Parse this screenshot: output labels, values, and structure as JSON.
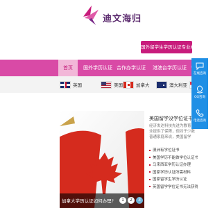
{
  "header": {
    "logo_text": "迪文海归",
    "slogan": "国外留学生学历认证专业机构"
  },
  "nav": {
    "items": [
      {
        "label": "首页",
        "active": true
      },
      {
        "label": "国外学历认证",
        "active": false
      },
      {
        "label": "合作办学认证",
        "active": false
      },
      {
        "label": "港澳台学历认证",
        "active": false
      },
      {
        "label": "留",
        "active": false
      }
    ]
  },
  "countries": [
    {
      "label": "英国",
      "icon": "uk-flag-icon"
    },
    {
      "label": "美国",
      "icon": "us-flag-icon"
    },
    {
      "label": "加拿大",
      "icon": "canada-flag-icon"
    },
    {
      "label": "澳大利亚",
      "icon": "australia-flag-icon"
    },
    {
      "label": "新加",
      "icon": "singapore-flag-icon"
    }
  ],
  "banner": {
    "caption": "加拿大学历认证如何办理?",
    "pages": [
      "1",
      "2",
      "3",
      "4"
    ],
    "active_page": "3"
  },
  "article": {
    "title": "美国留学没学位证书",
    "desc": "经济发达科技先进为教育事业提供了保障，但对于少数普通家庭来说，美国留学",
    "items": [
      "澳洲有学位证书",
      "美国学历不能做学位认证书",
      "马来西亚学历认证办理",
      "国家学历认证所需材料",
      "国家留学生学历认证",
      "英国留学学位证书无法获得"
    ]
  },
  "sidebar": {
    "items": [
      {
        "label": "在线咨询",
        "icon": "chat-icon"
      },
      {
        "label": "QQ咨询",
        "icon": "qq-icon"
      },
      {
        "label": "电话咨询",
        "icon": "phone-icon"
      }
    ]
  },
  "colors": {
    "nav_bg": "#d94aa6",
    "brand": "#c81c7c",
    "sidebar_bg": "#1f8fe5"
  }
}
